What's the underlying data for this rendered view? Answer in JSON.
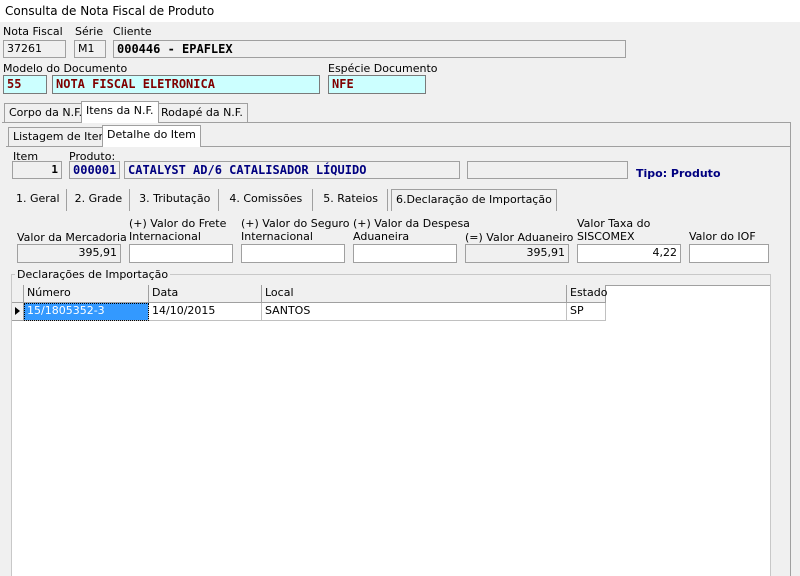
{
  "window": {
    "title": "Consulta de Nota Fiscal de Produto"
  },
  "header": {
    "nota_fiscal_label": "Nota Fiscal",
    "nota_fiscal_value": "37261",
    "serie_label": "Série",
    "serie_value": "M1",
    "cliente_label": "Cliente",
    "cliente_value": "000446 - EPAFLEX",
    "modelo_label": "Modelo do Documento",
    "modelo_code": "55",
    "modelo_desc": "NOTA FISCAL ELETRONICA",
    "especie_label": "Espécie Documento",
    "especie_value": "NFE"
  },
  "main_tabs": [
    {
      "label": "Corpo da N.F."
    },
    {
      "label": "Itens da N.F."
    },
    {
      "label": "Rodapé da N.F."
    }
  ],
  "sub_tabs": [
    {
      "label": "Listagem de Itens"
    },
    {
      "label": "Detalhe do Item"
    }
  ],
  "item": {
    "item_label": "Item",
    "item_value": "1",
    "produto_label": "Produto:",
    "produto_code": "000001",
    "produto_desc": "CATALYST AD/6 CATALISADOR LÍQUIDO",
    "extra_value": "",
    "tipo_text": "Tipo: Produto"
  },
  "detail_tabs": [
    {
      "label": "1. Geral"
    },
    {
      "label": "2. Grade"
    },
    {
      "label": "3. Tributação"
    },
    {
      "label": "4. Comissões"
    },
    {
      "label": "5. Rateios"
    },
    {
      "label": "6.Declaração de Importação"
    }
  ],
  "values": {
    "mercadoria_label": "Valor da Mercadoria",
    "mercadoria_value": "395,91",
    "frete_label1": "(+) Valor do Frete",
    "frete_label2": "Internacional",
    "frete_value": "",
    "seguro_label1": "(+) Valor do Seguro",
    "seguro_label2": "Internacional",
    "seguro_value": "",
    "despesa_label1": "(+) Valor da Despesa",
    "despesa_label2": "Aduaneira",
    "despesa_value": "",
    "aduaneiro_label": "(=) Valor Aduaneiro",
    "aduaneiro_value": "395,91",
    "siscomex_label1": "Valor Taxa do",
    "siscomex_label2": "SISCOMEX",
    "siscomex_value": "4,22",
    "iof_label": "Valor do IOF",
    "iof_value": ""
  },
  "declaracoes": {
    "group_label": "Declarações de Importação",
    "columns": [
      "Número",
      "Data",
      "Local",
      "Estado"
    ],
    "rows": [
      {
        "numero": "15/1805352-3",
        "data": "14/10/2015",
        "local": "SANTOS",
        "estado": "SP"
      }
    ]
  }
}
